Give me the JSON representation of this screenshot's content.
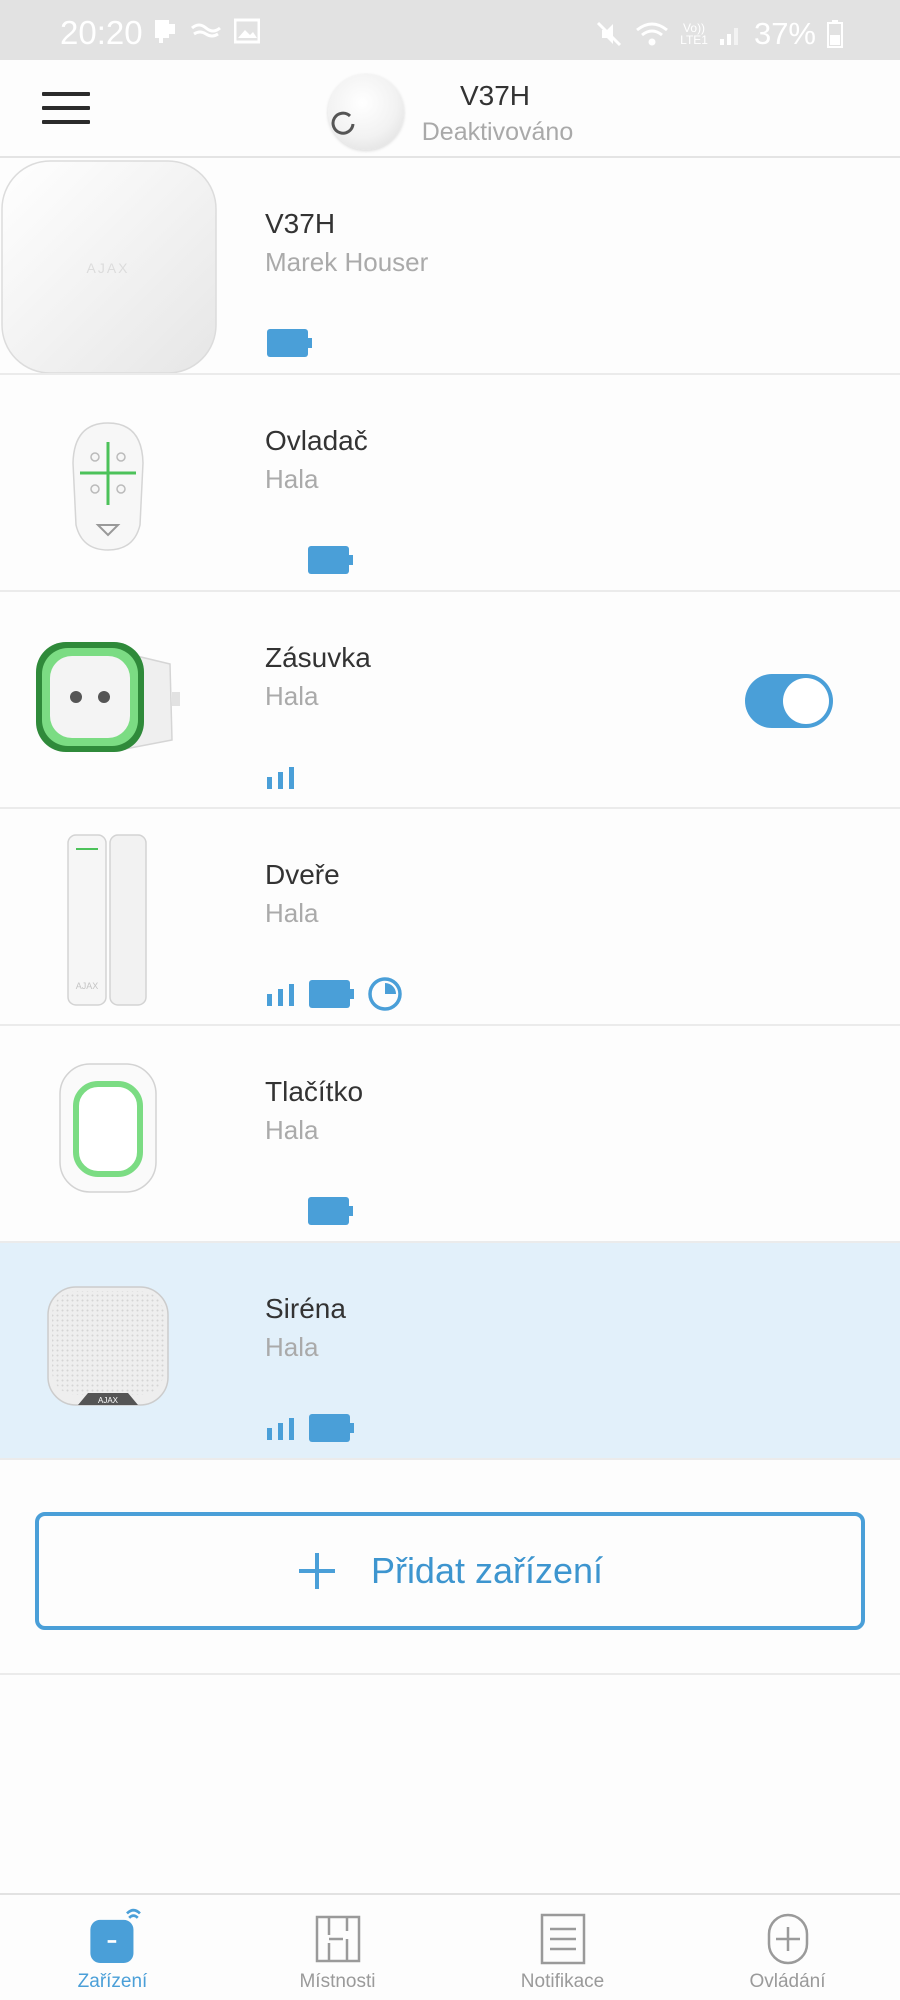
{
  "status_bar": {
    "time": "20:20",
    "battery_percent": "37%",
    "volte_label": "Vo))",
    "lte_label": "LTE1"
  },
  "header": {
    "hub_name": "V37H",
    "hub_state": "Deaktivováno"
  },
  "devices": [
    {
      "name": "V37H",
      "room": "Marek Houser",
      "icon": "hub-icon",
      "status_icons": [
        "battery"
      ]
    },
    {
      "name": "Ovladač",
      "room": "Hala",
      "icon": "keyfob-icon",
      "status_icons": [
        "battery"
      ]
    },
    {
      "name": "Zásuvka",
      "room": "Hala",
      "icon": "socket-icon",
      "status_icons": [
        "signal"
      ],
      "toggle_on": true
    },
    {
      "name": "Dveře",
      "room": "Hala",
      "icon": "door-sensor-icon",
      "status_icons": [
        "signal",
        "battery",
        "timer"
      ]
    },
    {
      "name": "Tlačítko",
      "room": "Hala",
      "icon": "button-icon",
      "status_icons": [
        "battery"
      ]
    },
    {
      "name": "Siréna",
      "room": "Hala",
      "icon": "siren-icon",
      "status_icons": [
        "signal",
        "battery"
      ],
      "selected": true
    }
  ],
  "device_logo_text": "AJAX",
  "add_device": {
    "label": "Přidat zařízení"
  },
  "bottom_nav": {
    "tabs": [
      {
        "label": "Zařízení",
        "icon": "devices-icon",
        "active": true
      },
      {
        "label": "Místnosti",
        "icon": "rooms-icon",
        "active": false
      },
      {
        "label": "Notifikace",
        "icon": "notifications-icon",
        "active": false
      },
      {
        "label": "Ovládání",
        "icon": "control-icon",
        "active": false
      }
    ]
  },
  "colors": {
    "accent": "#4a9fd8",
    "selected_row": "#e2f0fa",
    "led_green": "#4cc25a"
  }
}
